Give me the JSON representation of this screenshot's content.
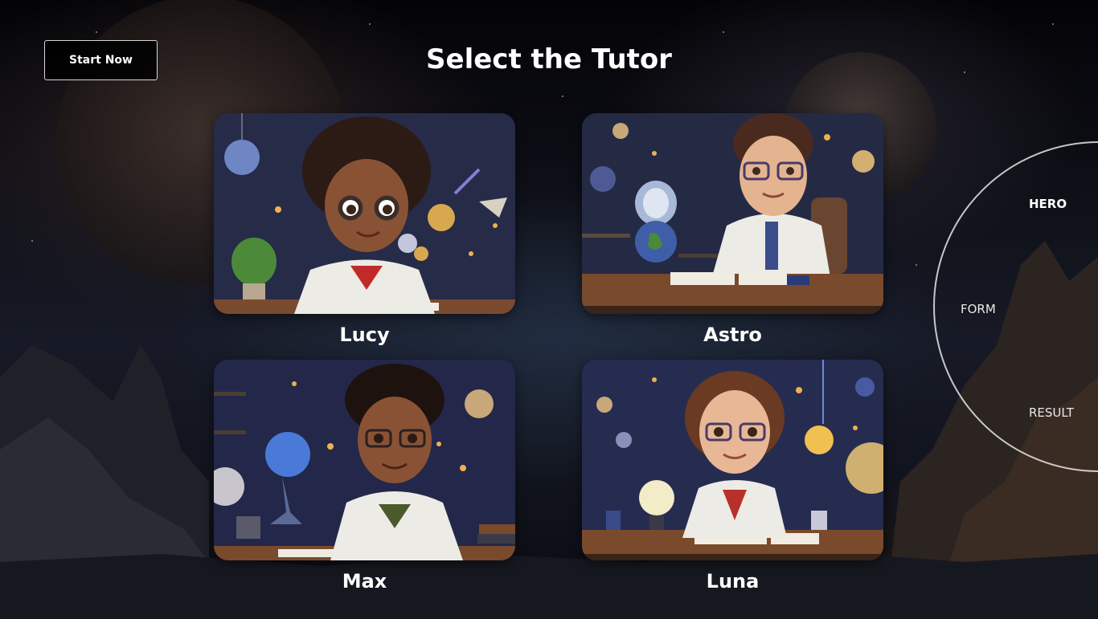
{
  "header": {
    "start_button_label": "Start Now",
    "title": "Select the Tutor"
  },
  "tutors": [
    {
      "name": "Lucy"
    },
    {
      "name": "Astro"
    },
    {
      "name": "Max"
    },
    {
      "name": "Luna"
    }
  ],
  "nav": {
    "items": [
      {
        "label": "HERO",
        "active": true
      },
      {
        "label": "FORM",
        "active": false
      },
      {
        "label": "RESULT",
        "active": false
      }
    ]
  }
}
